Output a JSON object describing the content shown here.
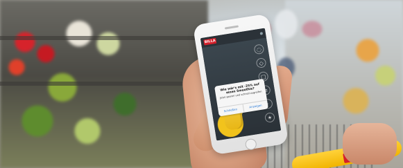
{
  "scene": {
    "background": "Supermarket aisle with blurred produce shelves and shoppers",
    "colors": {
      "brand_red": "#d41f2a",
      "dialog_link_blue": "#2b7bd6",
      "cart_yellow": "#ffd23a"
    }
  },
  "phone": {
    "app_logo_text": "BILLA",
    "dialog": {
      "title": "Wie wär's mit -25% auf einen Smoothie?",
      "body": "Jetzt sparen und schnell zugreifen",
      "buttons": [
        "Schließen",
        "Anzeigen"
      ]
    },
    "side_icons": [
      "bell-icon",
      "tag-icon",
      "cart-icon",
      "list-icon",
      "user-icon",
      "settings-icon"
    ]
  }
}
